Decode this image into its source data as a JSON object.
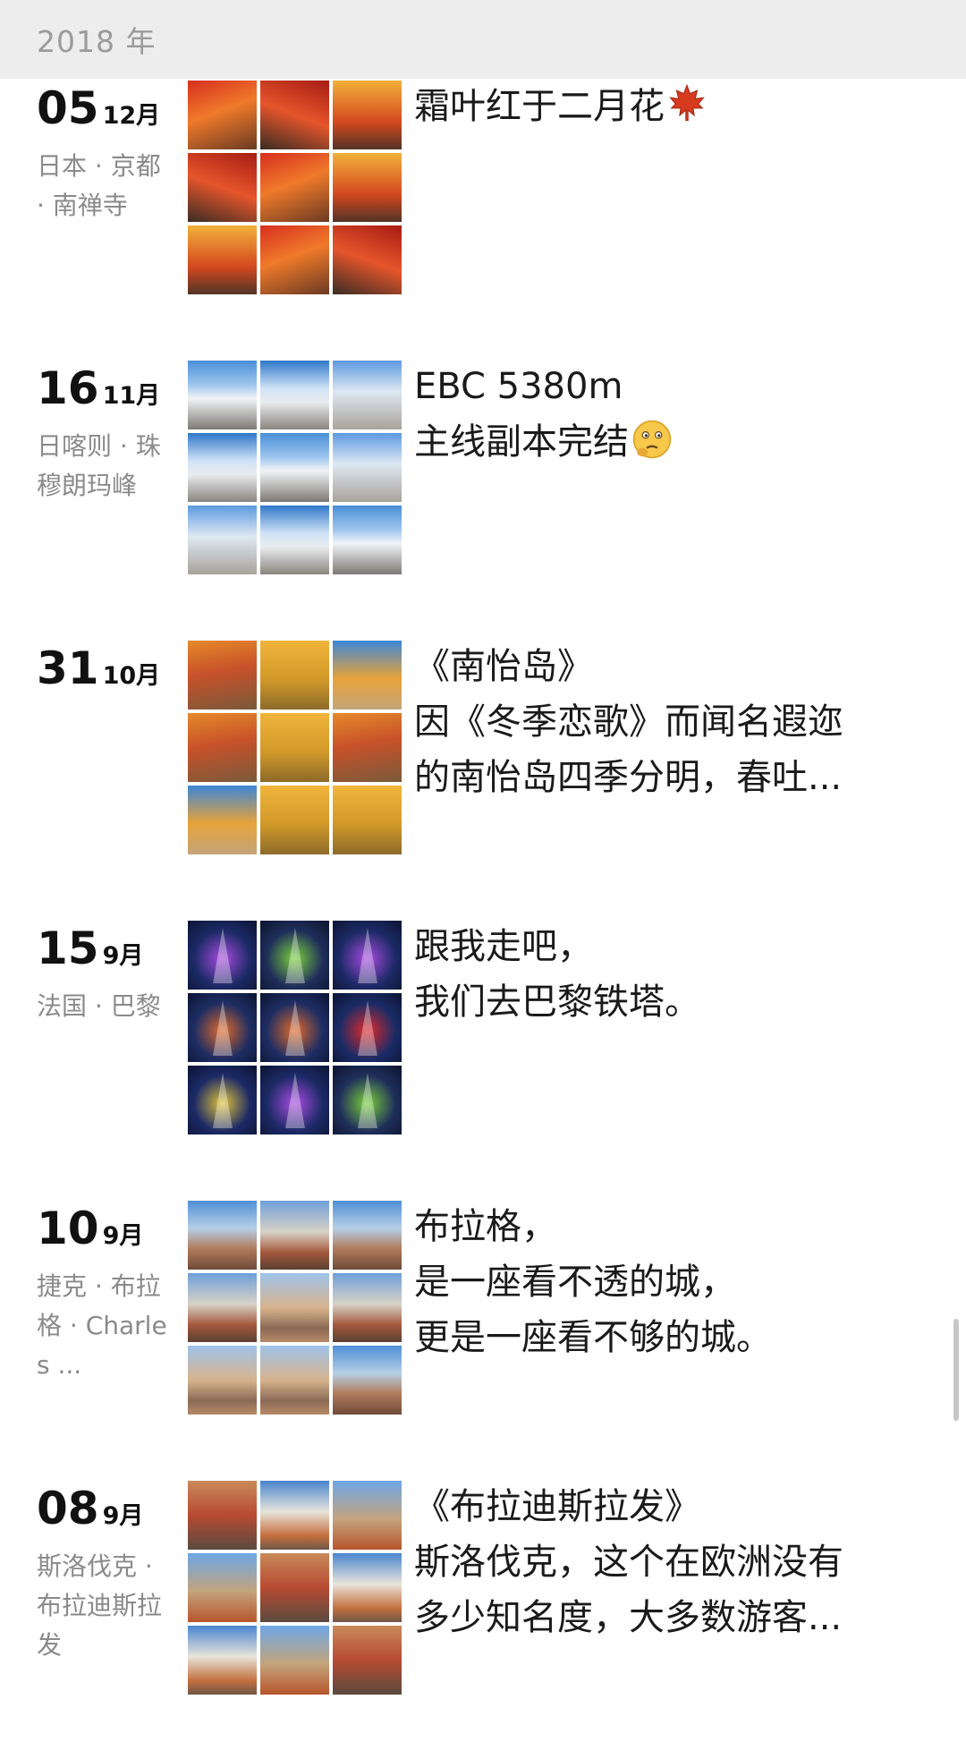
{
  "header": {
    "year": "2018 年"
  },
  "posts": [
    {
      "day": "05",
      "month": "12月",
      "location": "日本 · 京都 · 南禅寺",
      "caption": [
        "霜叶红于二月花"
      ],
      "emoji": "maple-leaf-icon",
      "palette": [
        "maple1",
        "maple2",
        "maple3",
        "maple2",
        "maple1",
        "maple3",
        "maple3",
        "maple1",
        "maple2"
      ]
    },
    {
      "day": "16",
      "month": "11月",
      "location": "日喀则 · 珠穆朗玛峰",
      "caption": [
        "EBC 5380m",
        "主线副本完结"
      ],
      "emoji": "thinking-face-icon",
      "palette": [
        "snow1",
        "snow2",
        "snow3",
        "snow2",
        "snow1",
        "snow3",
        "snow3",
        "snow2",
        "snow1"
      ]
    },
    {
      "day": "31",
      "month": "10月",
      "location": "",
      "caption": [
        "《南怡岛》",
        "因《冬季恋歌》而闻名遐迩",
        "的南怡岛四季分明，春吐..."
      ],
      "emoji": "",
      "palette": [
        "autumn1",
        "autumn2",
        "autumn3",
        "autumn1",
        "autumn2",
        "autumn1",
        "autumn3",
        "autumn2",
        "autumn2"
      ]
    },
    {
      "day": "15",
      "month": "9月",
      "location": "法国 · 巴黎",
      "caption": [
        "跟我走吧，",
        "我们去巴黎铁塔。"
      ],
      "emoji": "",
      "palette": [
        "eiffel1",
        "eiffel2",
        "eiffel1",
        "eiffel3",
        "eiffel3",
        "eiffel4",
        "eiffel5",
        "eiffel1",
        "eiffel2"
      ]
    },
    {
      "day": "10",
      "month": "9月",
      "location": "捷克 · 布拉格 · Charles ...",
      "caption": [
        "布拉格，",
        "是一座看不透的城，",
        "更是一座看不够的城。"
      ],
      "emoji": "",
      "palette": [
        "prague1",
        "prague2",
        "prague1",
        "prague2",
        "prague3",
        "prague2",
        "prague3",
        "prague3",
        "prague1"
      ]
    },
    {
      "day": "08",
      "month": "9月",
      "location": "斯洛伐克 · 布拉迪斯拉发",
      "caption": [
        "《布拉迪斯拉发》",
        "斯洛伐克，这个在欧洲没有",
        "多少知名度，大多数游客..."
      ],
      "emoji": "",
      "palette": [
        "brat1",
        "brat2",
        "brat3",
        "brat3",
        "brat1",
        "brat2",
        "brat2",
        "brat3",
        "brat1"
      ]
    }
  ]
}
